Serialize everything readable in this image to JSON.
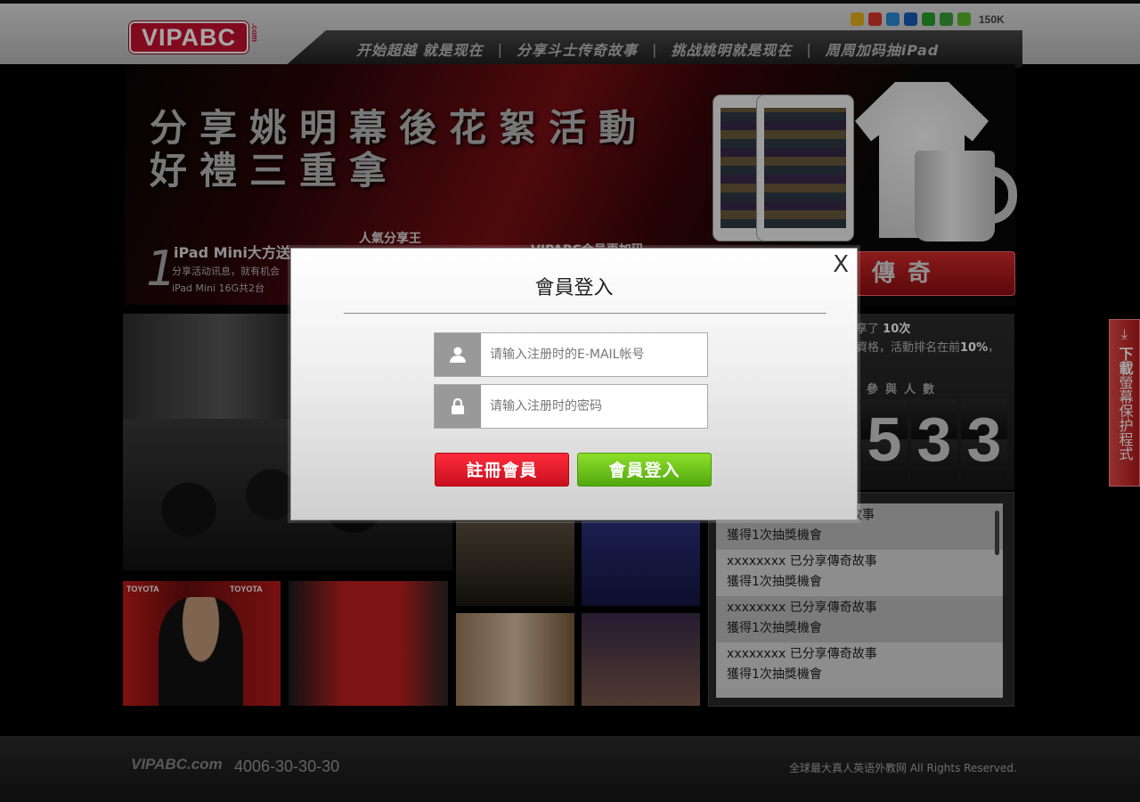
{
  "header": {
    "logo_text": "VIPABC",
    "logo_suffix": ".com",
    "nav": [
      {
        "label": "开始超越 就是现在"
      },
      {
        "label": "分享斗士传奇故事"
      },
      {
        "label": "挑战姚明就是现在"
      },
      {
        "label": "周周加码抽iPad"
      }
    ],
    "nav_separator": "|",
    "share_count": "150K",
    "share_icons": [
      {
        "name": "qzone-icon",
        "color": "#e8b21c"
      },
      {
        "name": "weibo-icon",
        "color": "#d8382a"
      },
      {
        "name": "tencent-weibo-icon",
        "color": "#2a8ad8"
      },
      {
        "name": "renren-icon",
        "color": "#1a5ab8"
      },
      {
        "name": "douban-icon",
        "color": "#2aa02a"
      },
      {
        "name": "kaixin-icon",
        "color": "#3aa03a"
      },
      {
        "name": "more-icon",
        "color": "#5ab82a"
      }
    ]
  },
  "banner": {
    "title_line1": "分享姚明幕後花絮活動",
    "title_line2": "好禮三重拿",
    "step1_num": "1",
    "step1_title": "iPad Mini大方送",
    "step1_desc": "分享活动讯息，就有机会",
    "step1_desc2": "iPad Mini 16G共2台",
    "step2_title": "人氣分享王",
    "step3_title": "VIPABC会员再加码",
    "legend_button": "傳奇"
  },
  "right_panel": {
    "line1_prefix": "享了",
    "line1_value": "10次",
    "line2_prefix": "資格，活動排名在前",
    "line2_value": "10%",
    "line2_suffix": "，",
    "count_label": "參與人數",
    "digits": [
      "5",
      "3",
      "3"
    ]
  },
  "feed": [
    {
      "line1": "故事",
      "line2": "獲得1次抽獎機會"
    },
    {
      "line1": "xxxxxxxx 已分享傳奇故事",
      "line2": "獲得1次抽獎機會"
    },
    {
      "line1": "xxxxxxxx 已分享傳奇故事",
      "line2": "獲得1次抽獎機會"
    },
    {
      "line1": "xxxxxxxx 已分享傳奇故事",
      "line2": "獲得1次抽獎機會"
    }
  ],
  "side_tab": {
    "title": "下載",
    "rest": "螢幕保护程式"
  },
  "footer": {
    "logo": "VIPABC.com",
    "phone": "4006-30-30-30",
    "copyright": "全球最大真人英语外教网  All Rights Reserved."
  },
  "modal": {
    "close": "X",
    "title": "會員登入",
    "email_placeholder": "请输入注册时的E-MAIL帐号",
    "email_value": "",
    "password_placeholder": "请输入注册时的密码",
    "password_value": "",
    "register_label": "註冊會員",
    "login_label": "會員登入"
  },
  "colors": {
    "brand_red": "#c8102e",
    "login_green": "#6cc31a",
    "register_red": "#e0192a"
  }
}
